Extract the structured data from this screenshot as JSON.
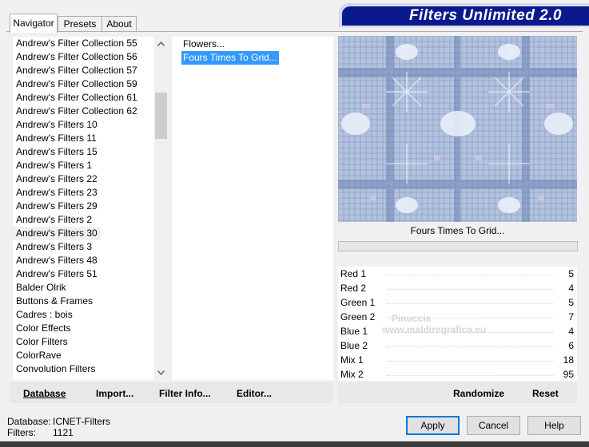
{
  "tabs": [
    {
      "label": "Navigator",
      "active": true
    },
    {
      "label": "Presets",
      "active": false
    },
    {
      "label": "About",
      "active": false
    }
  ],
  "banner_title": "Filters Unlimited 2.0",
  "categories": [
    "Andrew's Filter Collection 55",
    "Andrew's Filter Collection 56",
    "Andrew's Filter Collection 57",
    "Andrew's Filter Collection 59",
    "Andrew's Filter Collection 61",
    "Andrew's Filter Collection 62",
    "Andrew's Filters 10",
    "Andrew's Filters 11",
    "Andrew's Filters 15",
    "Andrew's Filters 1",
    "Andrew's Filters 22",
    "Andrew's Filters 23",
    "Andrew's Filters 29",
    "Andrew's Filters 2",
    "Andrew's Filters 30",
    "Andrew's Filters 3",
    "Andrew's Filters 48",
    "Andrew's Filters 51",
    "Balder Olrik",
    "Buttons & Frames",
    "Cadres : bois",
    "Color Effects",
    "Color Filters",
    "ColorRave",
    "Convolution Filters"
  ],
  "selected_category": "Andrew's Filters 30",
  "filters": [
    "Flowers...",
    "Fours Times To Grid..."
  ],
  "selected_filter": "Fours Times To Grid...",
  "preview_label": "Fours Times To Grid...",
  "parameters": [
    {
      "name": "Red 1",
      "value": "5"
    },
    {
      "name": "Red 2",
      "value": "4"
    },
    {
      "name": "Green 1",
      "value": "5"
    },
    {
      "name": "Green 2",
      "value": "7"
    },
    {
      "name": "Blue 1",
      "value": "4"
    },
    {
      "name": "Blue 2",
      "value": "6"
    },
    {
      "name": "Mix 1",
      "value": "18"
    },
    {
      "name": "Mix 2",
      "value": "95"
    }
  ],
  "bottom_buttons": {
    "database": "Database",
    "import": "Import...",
    "filter_info": "Filter Info...",
    "editor": "Editor...",
    "randomize": "Randomize",
    "reset": "Reset"
  },
  "status": {
    "database_label": "Database:",
    "database_value": "ICNET-Filters",
    "filters_label": "Filters:",
    "filters_value": "1121"
  },
  "dialog_buttons": {
    "apply": "Apply",
    "cancel": "Cancel",
    "help": "Help"
  },
  "watermark": {
    "line1": "Pinuccia",
    "line2": "www.maldiregrafica.eu"
  },
  "icons": {
    "scroll_up": "chevron-up-icon",
    "scroll_down": "chevron-down-icon"
  },
  "colors": {
    "banner": "#0a1a8c",
    "selection": "#3399ff",
    "preview_blue": "#9fb4d6"
  }
}
